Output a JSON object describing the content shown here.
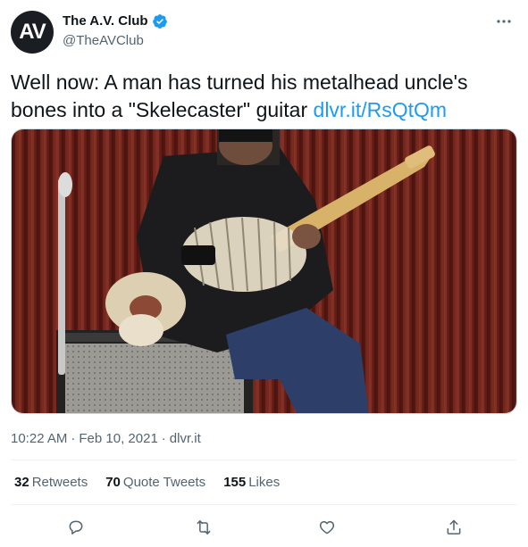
{
  "account": {
    "avatar_text": "AV",
    "display_name": "The A.V. Club",
    "handle": "@TheAVClub",
    "verified": true
  },
  "tweet": {
    "text": "Well now: A man has turned his metalhead uncle's bones into a \"Skelecaster\" guitar ",
    "link_text": "dlvr.it/RsQtQm"
  },
  "meta": {
    "time": "10:22 AM",
    "date": "Feb 10, 2021",
    "source": "dlvr.it",
    "separator": "·"
  },
  "stats": [
    {
      "count": "32",
      "label": "Retweets"
    },
    {
      "count": "70",
      "label": "Quote Tweets"
    },
    {
      "count": "155",
      "label": "Likes"
    }
  ],
  "actions": [
    "reply-icon",
    "retweet-icon",
    "like-icon",
    "share-icon"
  ],
  "colors": {
    "link": "#1d9bf0",
    "secondary_text": "#536471",
    "verified": "#1d9bf0"
  }
}
